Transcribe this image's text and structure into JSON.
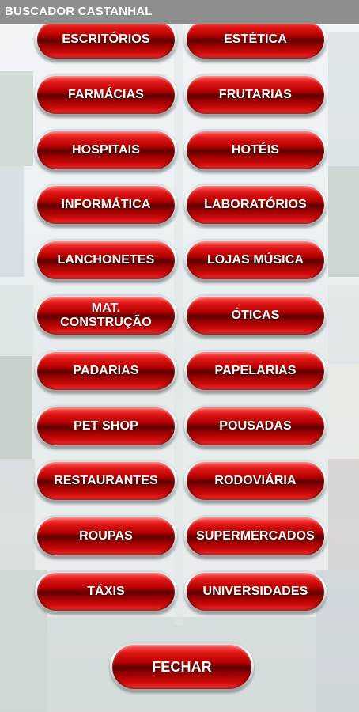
{
  "app": {
    "title": "BUSCADOR CASTANHAL"
  },
  "colors": {
    "titlebar": "#8e8e8e",
    "button_red": "#c40000",
    "button_text": "#ffffff"
  },
  "categories": [
    {
      "left": "ESCRITÓRIOS",
      "right": "ESTÉTICA"
    },
    {
      "left": "FARMÁCIAS",
      "right": "FRUTARIAS"
    },
    {
      "left": "HOSPITAIS",
      "right": "HOTÉIS"
    },
    {
      "left": "INFORMÁTICA",
      "right": "LABORATÓRIOS"
    },
    {
      "left": "LANCHONETES",
      "right": "LOJAS MÚSICA"
    },
    {
      "left": "MAT.\nCONSTRUÇÃO",
      "right": "ÓTICAS"
    },
    {
      "left": "PADARIAS",
      "right": "PAPELARIAS"
    },
    {
      "left": "PET SHOP",
      "right": "POUSADAS"
    },
    {
      "left": "RESTAURANTES",
      "right": "RODOVIÁRIA"
    },
    {
      "left": "ROUPAS",
      "right": "SUPERMERCADOS"
    },
    {
      "left": "TÁXIS",
      "right": "UNIVERSIDADES"
    }
  ],
  "close_button": {
    "label": "FECHAR"
  }
}
